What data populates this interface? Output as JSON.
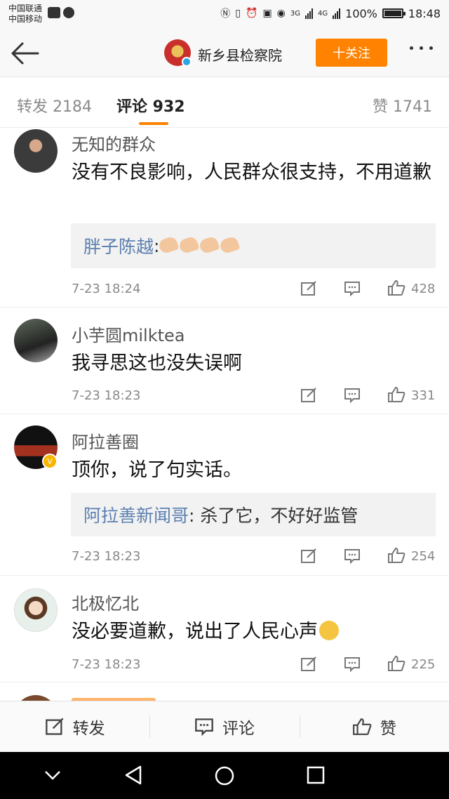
{
  "status_bar": {
    "carrier_1": "中国联通",
    "carrier_2": "中国移动",
    "network_1": "3G",
    "network_2": "4G",
    "battery": "100%",
    "time": "18:48"
  },
  "nav": {
    "account_name": "新乡县检察院",
    "follow_label": "十关注"
  },
  "tabs": {
    "repost": "转发 2184",
    "comment": "评论 932",
    "like": "赞 1741"
  },
  "comments": [
    {
      "user": "无知的群众",
      "text": "没有不良影响，人民群众很支持，不用道歉",
      "reply_user": "胖子陈越",
      "reply_sep": ": ",
      "time": "7-23 18:24",
      "likes": "428"
    },
    {
      "user": "小芋圆milktea",
      "text": "我寻思这也没失误啊",
      "time": "7-23 18:23",
      "likes": "331"
    },
    {
      "user": "阿拉善圈",
      "text": "顶你，说了句实话。",
      "reply_user": "阿拉善新闻哥",
      "reply_text": ": 杀了它，不好好监管",
      "time": "7-23 18:23",
      "likes": "254"
    },
    {
      "user": "北极忆北",
      "text": "没必要道歉，说出了人民心声",
      "time": "7-23 18:23",
      "likes": "225"
    }
  ],
  "toolbar": {
    "repost": "转发",
    "comment": "评论",
    "like": "赞"
  },
  "colors": {
    "accent": "#ff8200",
    "link": "#5b7fb0"
  }
}
